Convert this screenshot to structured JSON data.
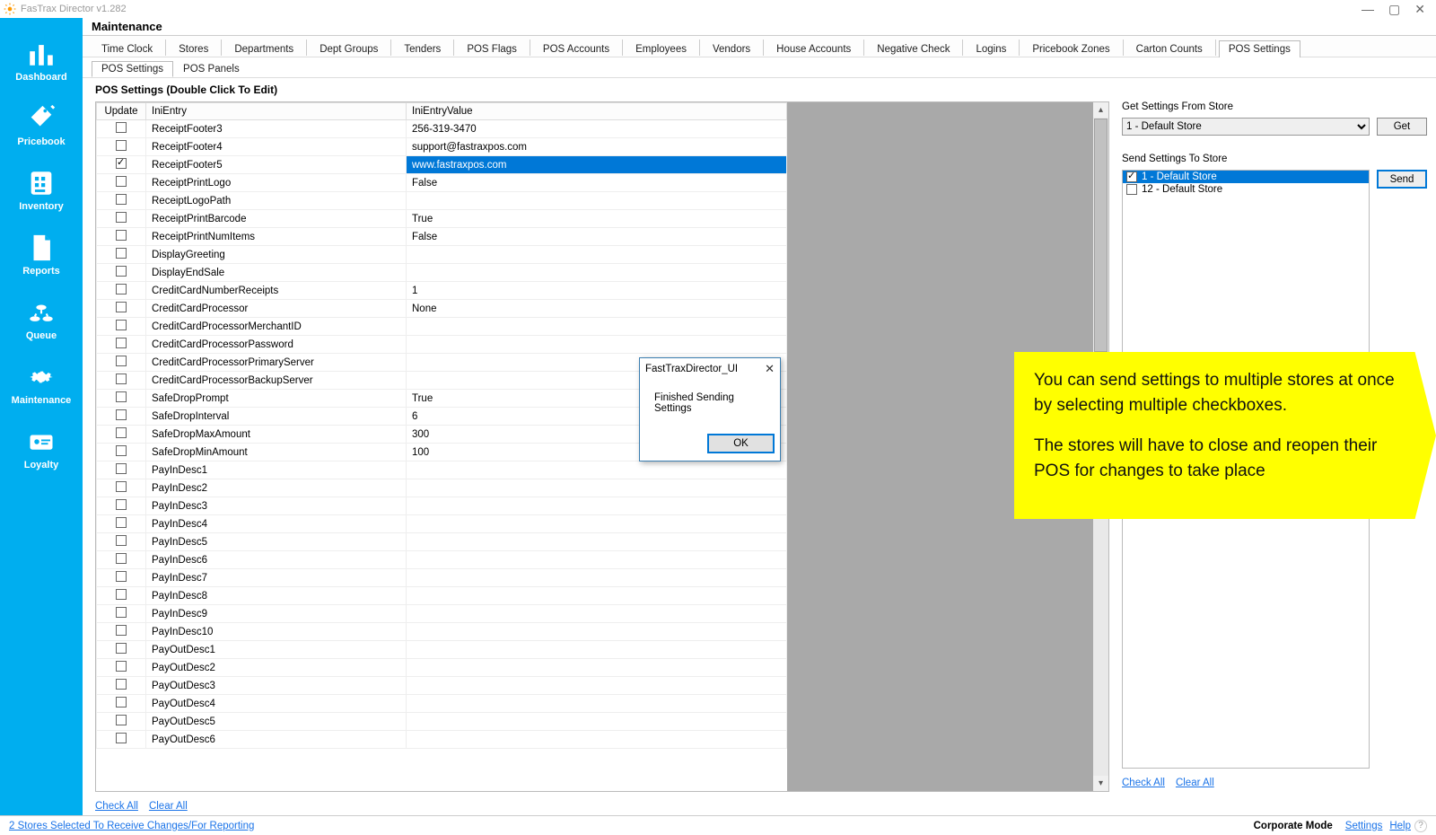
{
  "titlebar": {
    "text": "FasTrax Director v1.282"
  },
  "sidebar": [
    {
      "key": "dashboard",
      "label": "Dashboard"
    },
    {
      "key": "pricebook",
      "label": "Pricebook"
    },
    {
      "key": "inventory",
      "label": "Inventory"
    },
    {
      "key": "reports",
      "label": "Reports"
    },
    {
      "key": "queue",
      "label": "Queue"
    },
    {
      "key": "maintenance",
      "label": "Maintenance"
    },
    {
      "key": "loyalty",
      "label": "Loyalty"
    }
  ],
  "section_title": "Maintenance",
  "tabs1": [
    "Time Clock",
    "Stores",
    "Departments",
    "Dept Groups",
    "Tenders",
    "POS Flags",
    "POS Accounts",
    "Employees",
    "Vendors",
    "House Accounts",
    "Negative Check",
    "Logins",
    "Pricebook Zones",
    "Carton Counts",
    "POS Settings"
  ],
  "tabs1_active": 14,
  "tabs2": [
    "POS Settings",
    "POS Panels"
  ],
  "tabs2_active": 0,
  "subheader": "POS Settings (Double Click To Edit)",
  "columns": {
    "update": "Update",
    "entry": "IniEntry",
    "value": "IniEntryValue"
  },
  "rows": [
    {
      "checked": false,
      "entry": "ReceiptFooter3",
      "value": "256-319-3470",
      "selected": false
    },
    {
      "checked": false,
      "entry": "ReceiptFooter4",
      "value": "support@fastraxpos.com",
      "selected": false
    },
    {
      "checked": true,
      "entry": "ReceiptFooter5",
      "value": "www.fastraxpos.com",
      "selected": true
    },
    {
      "checked": false,
      "entry": "ReceiptPrintLogo",
      "value": "False",
      "selected": false
    },
    {
      "checked": false,
      "entry": "ReceiptLogoPath",
      "value": "",
      "selected": false
    },
    {
      "checked": false,
      "entry": "ReceiptPrintBarcode",
      "value": "True",
      "selected": false
    },
    {
      "checked": false,
      "entry": "ReceiptPrintNumItems",
      "value": "False",
      "selected": false
    },
    {
      "checked": false,
      "entry": "DisplayGreeting",
      "value": "",
      "selected": false
    },
    {
      "checked": false,
      "entry": "DisplayEndSale",
      "value": "",
      "selected": false
    },
    {
      "checked": false,
      "entry": "CreditCardNumberReceipts",
      "value": "1",
      "selected": false
    },
    {
      "checked": false,
      "entry": "CreditCardProcessor",
      "value": "None",
      "selected": false
    },
    {
      "checked": false,
      "entry": "CreditCardProcessorMerchantID",
      "value": "",
      "selected": false
    },
    {
      "checked": false,
      "entry": "CreditCardProcessorPassword",
      "value": "",
      "selected": false
    },
    {
      "checked": false,
      "entry": "CreditCardProcessorPrimaryServer",
      "value": "",
      "selected": false
    },
    {
      "checked": false,
      "entry": "CreditCardProcessorBackupServer",
      "value": "",
      "selected": false
    },
    {
      "checked": false,
      "entry": "SafeDropPrompt",
      "value": "True",
      "selected": false
    },
    {
      "checked": false,
      "entry": "SafeDropInterval",
      "value": "6",
      "selected": false
    },
    {
      "checked": false,
      "entry": "SafeDropMaxAmount",
      "value": "300",
      "selected": false
    },
    {
      "checked": false,
      "entry": "SafeDropMinAmount",
      "value": "100",
      "selected": false
    },
    {
      "checked": false,
      "entry": "PayInDesc1",
      "value": "",
      "selected": false
    },
    {
      "checked": false,
      "entry": "PayInDesc2",
      "value": "",
      "selected": false
    },
    {
      "checked": false,
      "entry": "PayInDesc3",
      "value": "",
      "selected": false
    },
    {
      "checked": false,
      "entry": "PayInDesc4",
      "value": "",
      "selected": false
    },
    {
      "checked": false,
      "entry": "PayInDesc5",
      "value": "",
      "selected": false
    },
    {
      "checked": false,
      "entry": "PayInDesc6",
      "value": "",
      "selected": false
    },
    {
      "checked": false,
      "entry": "PayInDesc7",
      "value": "",
      "selected": false
    },
    {
      "checked": false,
      "entry": "PayInDesc8",
      "value": "",
      "selected": false
    },
    {
      "checked": false,
      "entry": "PayInDesc9",
      "value": "",
      "selected": false
    },
    {
      "checked": false,
      "entry": "PayInDesc10",
      "value": "",
      "selected": false
    },
    {
      "checked": false,
      "entry": "PayOutDesc1",
      "value": "",
      "selected": false
    },
    {
      "checked": false,
      "entry": "PayOutDesc2",
      "value": "",
      "selected": false
    },
    {
      "checked": false,
      "entry": "PayOutDesc3",
      "value": "",
      "selected": false
    },
    {
      "checked": false,
      "entry": "PayOutDesc4",
      "value": "",
      "selected": false
    },
    {
      "checked": false,
      "entry": "PayOutDesc5",
      "value": "",
      "selected": false
    },
    {
      "checked": false,
      "entry": "PayOutDesc6",
      "value": "",
      "selected": false
    }
  ],
  "right": {
    "get_label": "Get Settings From Store",
    "get_select": "1 - Default Store",
    "get_btn": "Get",
    "send_label": "Send Settings To Store",
    "send_btn": "Send",
    "stores": [
      {
        "label": "1 - Default Store",
        "checked": true,
        "selected": true
      },
      {
        "label": "12 - Default Store",
        "checked": false,
        "selected": false
      }
    ]
  },
  "links": {
    "check_all": "Check All",
    "clear_all": "Clear All"
  },
  "status": {
    "left": "2 Stores Selected To Receive Changes/For Reporting",
    "mode": "Corporate Mode",
    "settings": "Settings",
    "help": "Help"
  },
  "dialog": {
    "title": "FastTraxDirector_UI",
    "body": "Finished Sending Settings",
    "ok": "OK"
  },
  "callout": {
    "p1": "You can send settings to multiple stores at once by selecting multiple checkboxes.",
    "p2": "The stores will have to close and reopen their POS for changes to take place"
  }
}
